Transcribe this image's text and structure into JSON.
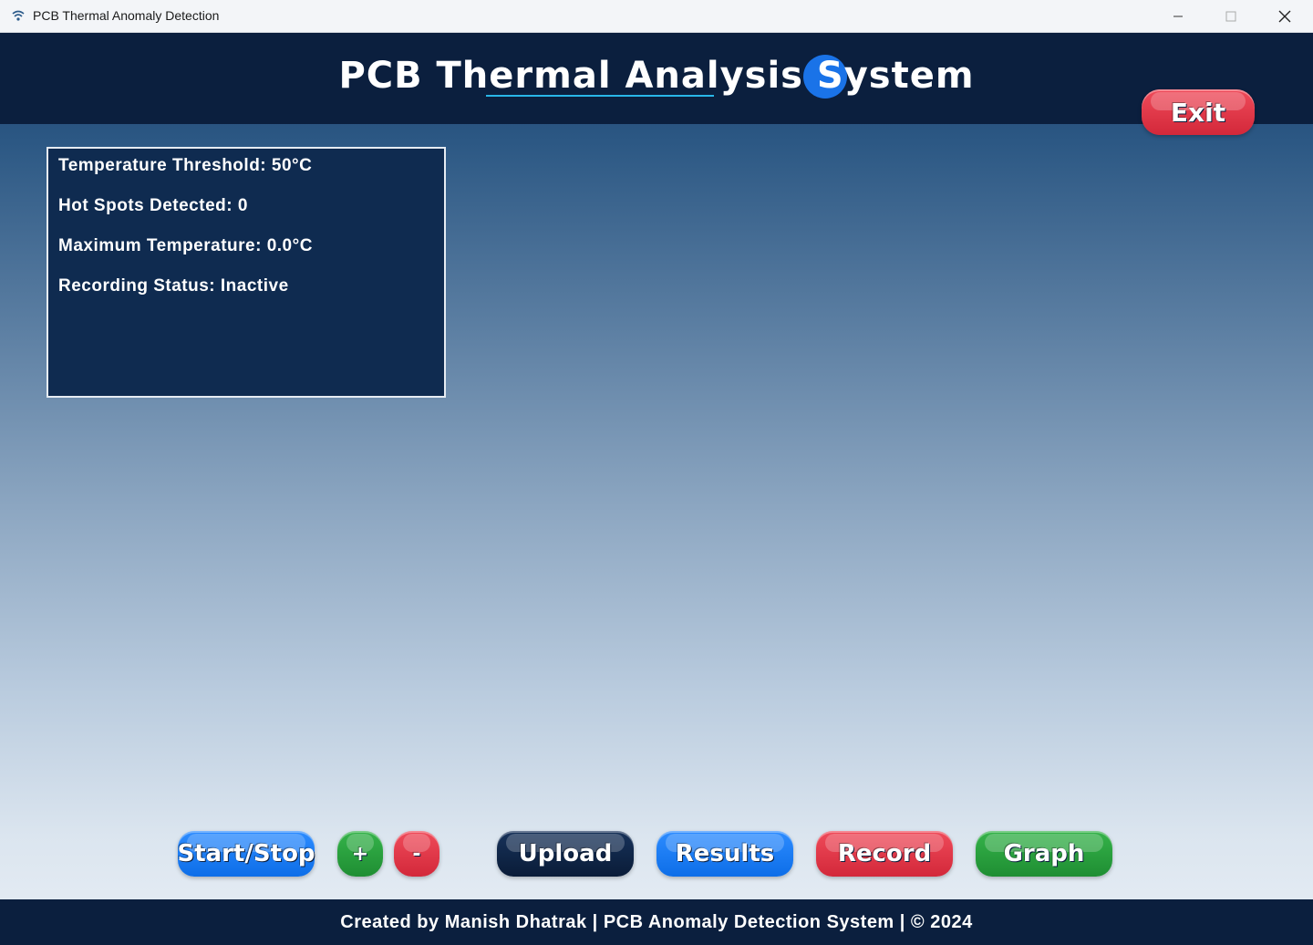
{
  "window": {
    "title": "PCB Thermal Anomaly Detection",
    "app_icon": "wifi-waves-icon",
    "controls": [
      "minimize-icon",
      "maximize-icon",
      "close-icon"
    ]
  },
  "header": {
    "title": "PCB Thermal Analysis System"
  },
  "exit_button": {
    "label": "Exit"
  },
  "status": {
    "threshold": "Temperature Threshold: 50°C",
    "hotspots": "Hot Spots Detected: 0",
    "max_temp": "Maximum Temperature: 0.0°C",
    "recording": "Recording Status: Inactive"
  },
  "toolbar": {
    "start_stop": "Start/Stop",
    "plus": "+",
    "minus": "-",
    "upload": "Upload",
    "results": "Results",
    "record": "Record",
    "graph": "Graph"
  },
  "footer": {
    "text": "Created by Manish Dhatrak | PCB Anomaly Detection System | © 2024"
  },
  "colors": {
    "header_bg": "#0b1f3e",
    "panel_bg": "#0f2b50",
    "red": "#dc3545",
    "blue": "#1a7ff0",
    "green": "#28a745",
    "navy": "#0b1f3e",
    "accent_underline": "#29b6e8"
  }
}
